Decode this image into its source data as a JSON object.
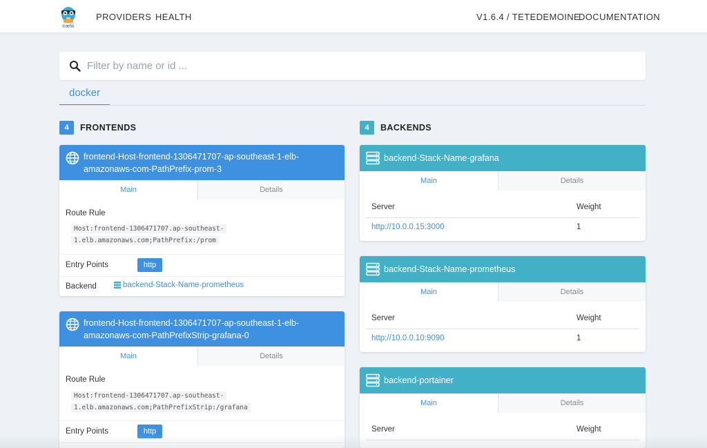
{
  "nav": {
    "logo_text": "træfik",
    "providers": "PROVIDERS",
    "health": "HEALTH",
    "version": "V1.6.4 / TETEDEMOINE",
    "documentation": "DOCUMENTATION"
  },
  "search": {
    "placeholder": "Filter by name or id ...",
    "value": ""
  },
  "provider_tab": "docker",
  "frontends": {
    "count": "4",
    "title": "FRONTENDS",
    "cards": [
      {
        "name_line1": "frontend-Host-frontend-1306471707-ap-southeast-1-elb-",
        "name_line2": "amazonaws-com-PathPrefix-prom-3",
        "tab_main": "Main",
        "tab_details": "Details",
        "route_rule_label": "Route Rule",
        "route_line1": "Host:frontend-1306471707.ap-southeast-",
        "route_line2": "1.elb.amazonaws.com;PathPrefix:/prom",
        "entry_points_label": "Entry Points",
        "entry_point": "http",
        "backend_label": "Backend",
        "backend": "backend-Stack-Name-prometheus"
      },
      {
        "name_line1": "frontend-Host-frontend-1306471707-ap-southeast-1-elb-",
        "name_line2": "amazonaws-com-PathPrefixStrip-grafana-0",
        "tab_main": "Main",
        "tab_details": "Details",
        "route_rule_label": "Route Rule",
        "route_line1": "Host:frontend-1306471707.ap-southeast-",
        "route_line2": "1.elb.amazonaws.com;PathPrefixStrip:/grafana",
        "entry_points_label": "Entry Points",
        "entry_point": "http"
      }
    ]
  },
  "backends": {
    "count": "4",
    "title": "BACKENDS",
    "cards": [
      {
        "name": "backend-Stack-Name-grafana",
        "tab_main": "Main",
        "tab_details": "Details",
        "col_server": "Server",
        "col_weight": "Weight",
        "server": "http://10.0.0.15:3000",
        "weight": "1"
      },
      {
        "name": "backend-Stack-Name-prometheus",
        "tab_main": "Main",
        "tab_details": "Details",
        "col_server": "Server",
        "col_weight": "Weight",
        "server": "http://10.0.0.10:9090",
        "weight": "1"
      },
      {
        "name": "backend-portainer",
        "tab_main": "Main",
        "tab_details": "Details",
        "col_server": "Server",
        "col_weight": "Weight"
      }
    ]
  },
  "colors": {
    "frontend_header": "#3e91e1",
    "backend_header": "#42b1c8",
    "link": "#3e91e1",
    "background": "#eef2f6"
  },
  "icons": {
    "logo": "traefik-gopher-logo",
    "search": "search-icon",
    "frontend": "globe-icon",
    "backend": "server-icon"
  }
}
